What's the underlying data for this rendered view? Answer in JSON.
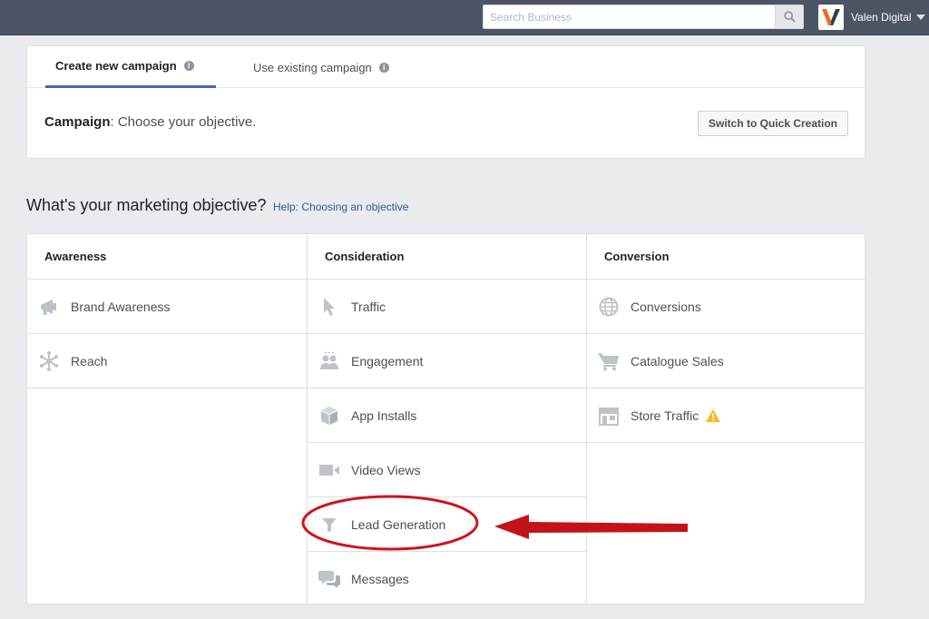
{
  "topbar": {
    "search": {
      "placeholder": "Search Business",
      "value": ""
    },
    "search_icon": "search-icon",
    "account": {
      "name": "Valen Digital",
      "logo_icon": "valen-digital-logo",
      "menu_icon": "caret-down-icon"
    }
  },
  "campaign": {
    "tabs": [
      {
        "label": "Create new campaign",
        "active": true,
        "icon": "info-icon"
      },
      {
        "label": "Use existing campaign",
        "active": false,
        "icon": "info-icon"
      }
    ],
    "label": "Campaign",
    "prompt": ": Choose your objective.",
    "quick_creation_button": "Switch to Quick Creation"
  },
  "objective": {
    "heading": "What's your marketing objective?",
    "help_link": "Help: Choosing an objective",
    "columns": [
      {
        "title": "Awareness",
        "items": [
          {
            "label": "Brand Awareness",
            "icon": "megaphone-icon"
          },
          {
            "label": "Reach",
            "icon": "reach-icon"
          }
        ]
      },
      {
        "title": "Consideration",
        "items": [
          {
            "label": "Traffic",
            "icon": "cursor-icon"
          },
          {
            "label": "Engagement",
            "icon": "people-icon"
          },
          {
            "label": "App Installs",
            "icon": "box-icon"
          },
          {
            "label": "Video Views",
            "icon": "video-camera-icon"
          },
          {
            "label": "Lead Generation",
            "icon": "funnel-icon"
          },
          {
            "label": "Messages",
            "icon": "chat-bubbles-icon"
          }
        ]
      },
      {
        "title": "Conversion",
        "items": [
          {
            "label": "Conversions",
            "icon": "globe-icon"
          },
          {
            "label": "Catalogue Sales",
            "icon": "shopping-cart-icon"
          },
          {
            "label": "Store Traffic",
            "icon": "store-icon",
            "badge_icon": "warning-icon"
          }
        ]
      }
    ]
  },
  "annotation": {
    "highlighted_item": "Lead Generation",
    "ellipse_color": "#d0121b",
    "arrow_color": "#c4121b"
  },
  "colors": {
    "topbar": "#4b5564",
    "accent": "#4267b2",
    "link": "#365899",
    "warning": "#f7b928"
  }
}
